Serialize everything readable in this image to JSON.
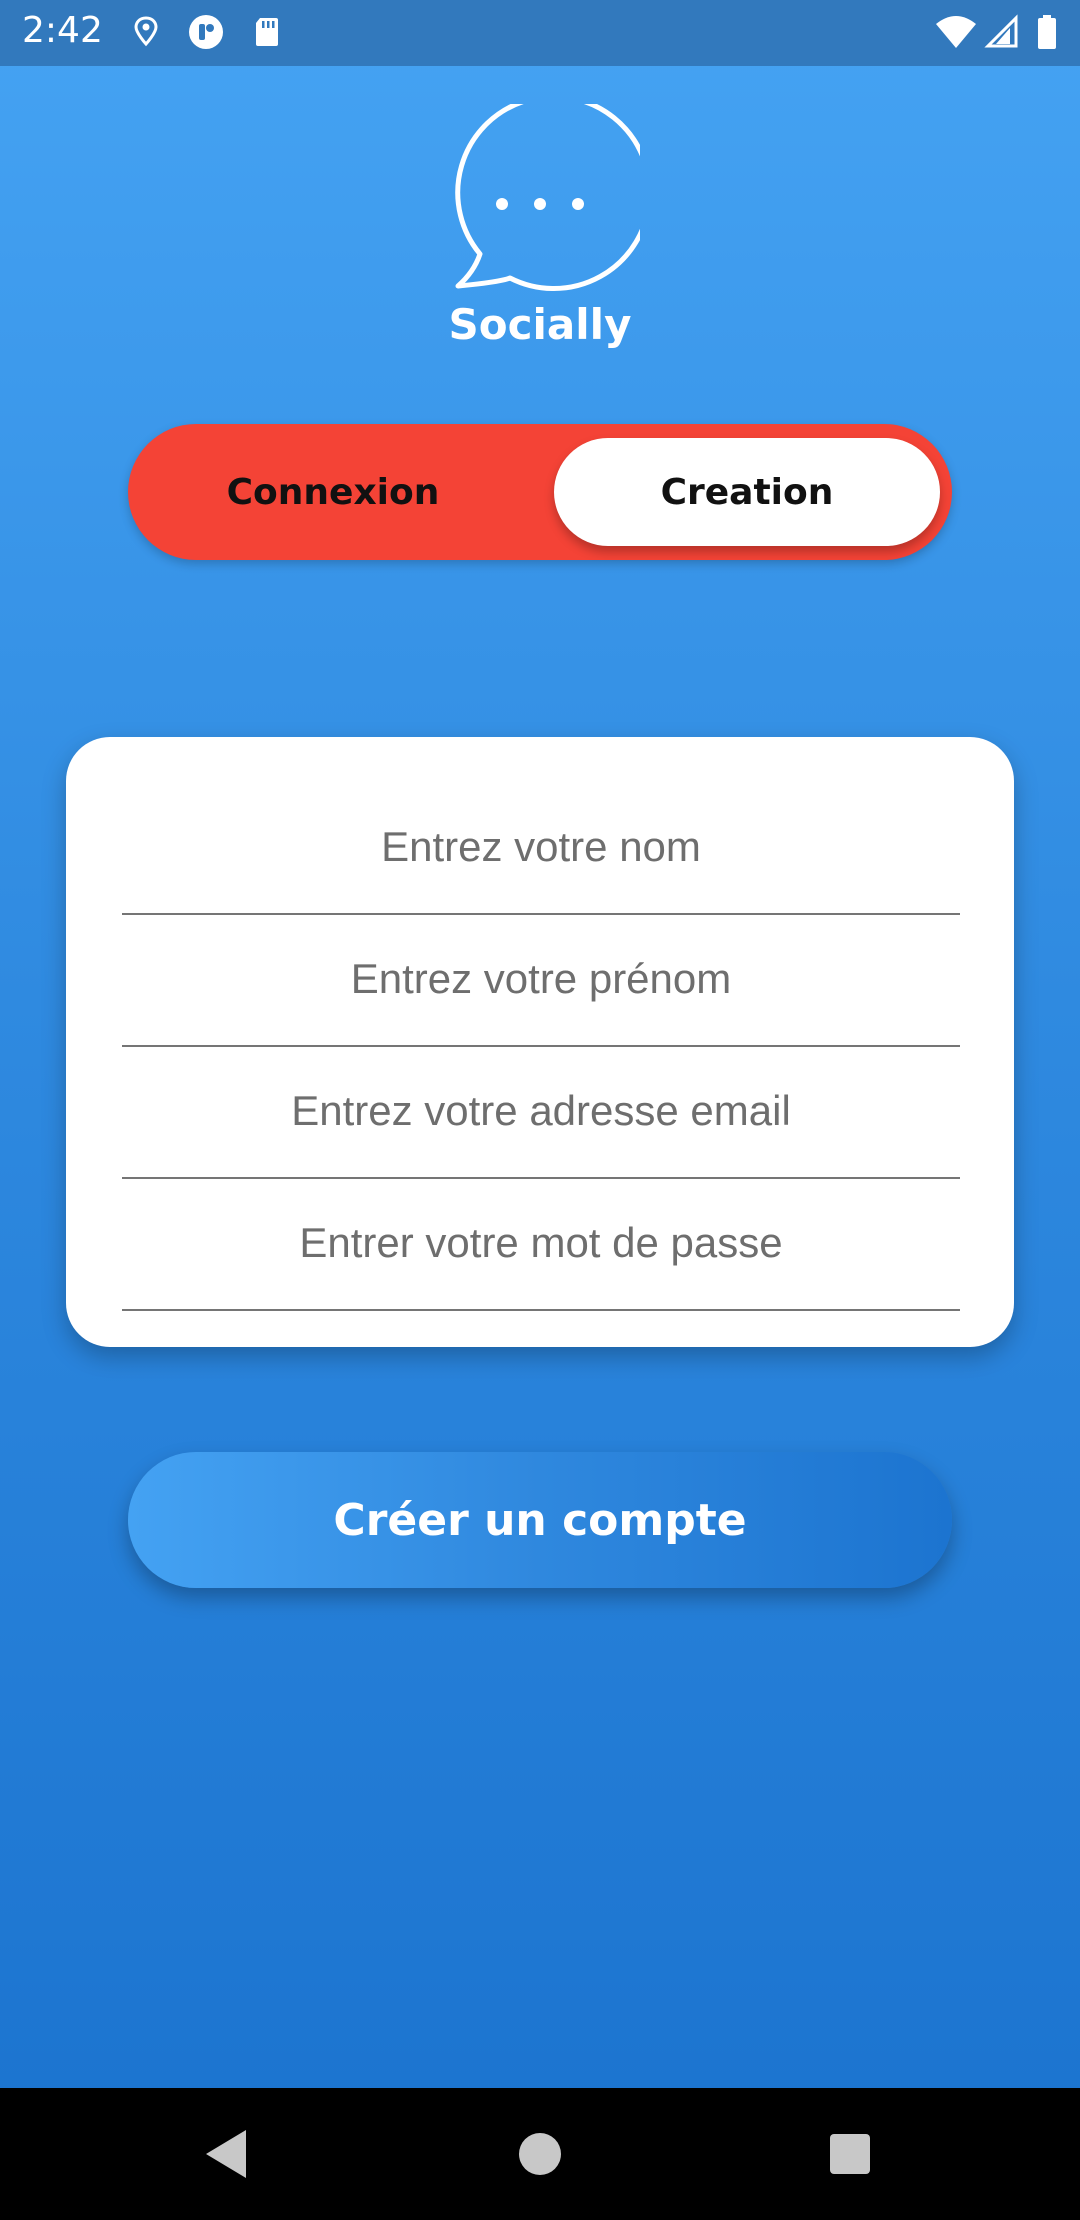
{
  "status_bar": {
    "time": "2:42",
    "icons": [
      "location-pin-icon",
      "app-notification-icon",
      "sd-card-icon",
      "wifi-icon",
      "signal-icon",
      "battery-icon"
    ]
  },
  "logo": {
    "brand": "Socially",
    "icon": "chat-bubble-icon"
  },
  "toggle": {
    "left_label": "Connexion",
    "right_label": "Creation",
    "selected": "Creation"
  },
  "form": {
    "fields": [
      {
        "placeholder": "Entrez votre nom",
        "value": ""
      },
      {
        "placeholder": "Entrez votre prénom",
        "value": ""
      },
      {
        "placeholder": "Entrez votre adresse email",
        "value": ""
      },
      {
        "placeholder": "Entrer votre mot de passe",
        "value": ""
      }
    ]
  },
  "cta_label": "Créer un compte",
  "nav_bar": {
    "icons": [
      "back-icon",
      "home-icon",
      "recents-icon"
    ]
  },
  "colors": {
    "background": "#2f8ae0",
    "accent_red": "#f44336",
    "status_bar": "#3279bd"
  }
}
